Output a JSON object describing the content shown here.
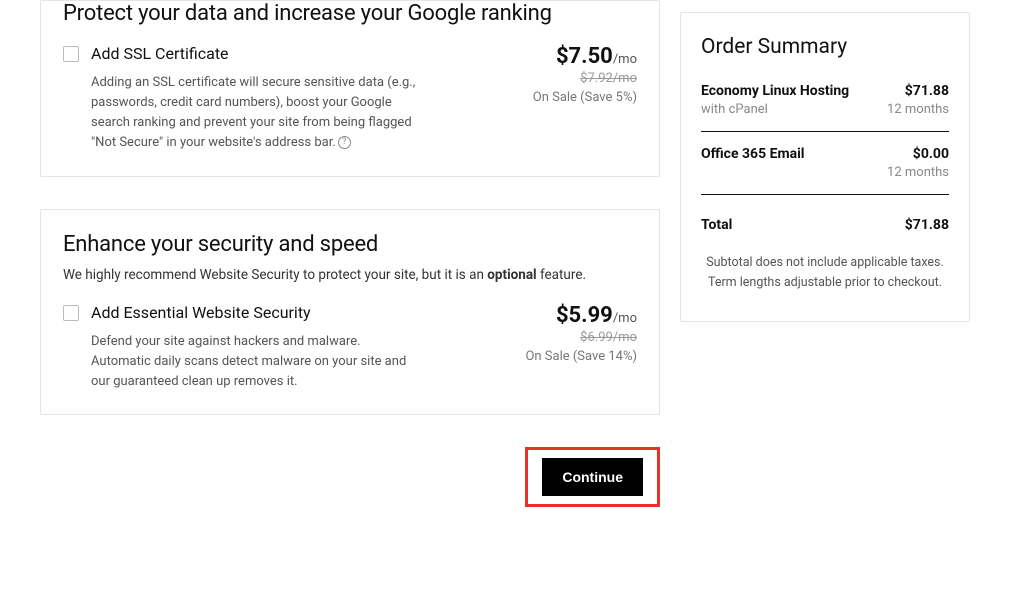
{
  "sections": {
    "ssl": {
      "heading": "Protect your data and increase your Google ranking",
      "checkbox_label": "Add SSL Certificate",
      "description": "Adding an SSL certificate will secure sensitive data (e.g., passwords, credit card numbers), boost your Google search ranking and prevent your site from being flagged \"Not Secure\" in your website's address bar.",
      "price": "$7.50",
      "price_unit": "/mo",
      "original_price": "$7.92/mo",
      "sale_text": "On Sale (Save 5%)"
    },
    "security": {
      "heading": "Enhance your security and speed",
      "subtext_prefix": "We highly recommend Website Security to protect your site, but it is an ",
      "subtext_bold": "optional",
      "subtext_suffix": " feature.",
      "checkbox_label": "Add Essential Website Security",
      "description": "Defend your site against hackers and malware. Automatic daily scans detect malware on your site and our guaranteed clean up removes it.",
      "price": "$5.99",
      "price_unit": "/mo",
      "original_price": "$6.99/mo",
      "sale_text": "On Sale (Save 14%)"
    }
  },
  "order_summary": {
    "heading": "Order Summary",
    "items": [
      {
        "name": "Economy Linux Hosting",
        "sub": "with cPanel",
        "price": "$71.88",
        "term": "12 months"
      },
      {
        "name": "Office 365 Email",
        "sub": "",
        "price": "$0.00",
        "term": "12 months"
      }
    ],
    "total_label": "Total",
    "total_value": "$71.88",
    "disclaimer_line1": "Subtotal does not include applicable taxes.",
    "disclaimer_line2": "Term lengths adjustable prior to checkout."
  },
  "continue_label": "Continue"
}
